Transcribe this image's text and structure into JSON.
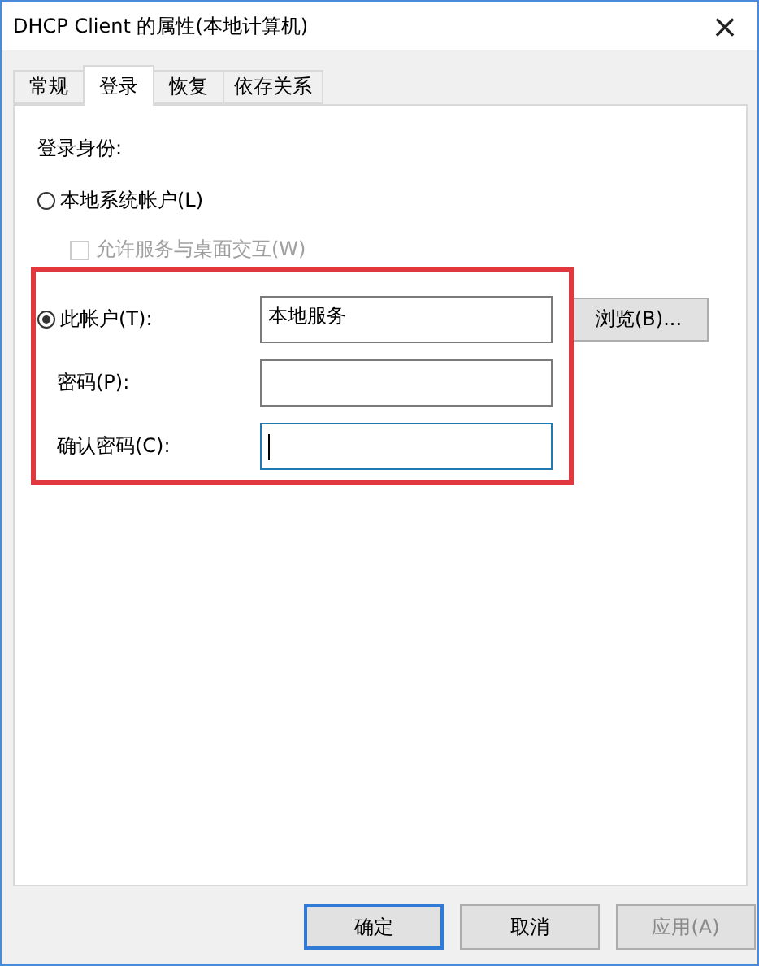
{
  "window": {
    "title": "DHCP Client 的属性(本地计算机)",
    "close": "×"
  },
  "tabs": [
    {
      "label": "常规",
      "selected": false
    },
    {
      "label": "登录",
      "selected": true
    },
    {
      "label": "恢复",
      "selected": false
    },
    {
      "label": "依存关系",
      "selected": false
    }
  ],
  "logon": {
    "heading": "登录身份:",
    "local_system": {
      "label": "本地系统帐户(L)",
      "selected": false
    },
    "desktop_interact": {
      "label": "允许服务与桌面交互(W)",
      "checked": false,
      "disabled": true
    },
    "this_account": {
      "label": "此帐户(T):",
      "selected": true,
      "value": "本地服务",
      "browse": "浏览(B)..."
    },
    "password": {
      "label": "密码(P):"
    },
    "confirm": {
      "label": "确认密码(C):",
      "focused": true
    }
  },
  "buttons": [
    {
      "label": "确定",
      "default": true,
      "disabled": false
    },
    {
      "label": "取消",
      "default": false,
      "disabled": false
    },
    {
      "label": "应用(A)",
      "default": false,
      "disabled": true
    }
  ]
}
